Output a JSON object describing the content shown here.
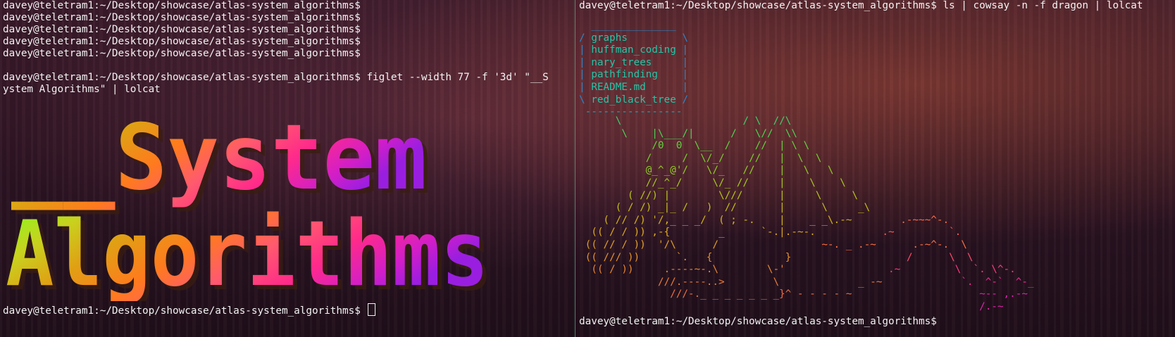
{
  "left_terminal": {
    "prompt": "davey@teletram1:~/Desktop/showcase/atlas-system_algorithms$",
    "history": [
      "davey@teletram1:~/Desktop/showcase/atlas-system_algorithms$",
      "davey@teletram1:~/Desktop/showcase/atlas-system_algorithms$",
      "davey@teletram1:~/Desktop/showcase/atlas-system_algorithms$",
      "davey@teletram1:~/Desktop/showcase/atlas-system_algorithms$",
      "davey@teletram1:~/Desktop/showcase/atlas-system_algorithms$"
    ],
    "command_line_1": "davey@teletram1:~/Desktop/showcase/atlas-system_algorithms$ figlet --width 77 -f '3d' \"__S",
    "command_line_2": "ystem Algorithms\" | lolcat",
    "banner_line_1": "__System",
    "banner_line_2": "Algorithms"
  },
  "right_terminal": {
    "command": "davey@teletram1:~/Desktop/showcase/atlas-system_algorithms$ ls | cowsay -n -f dragon | lolcat",
    "listing": [
      "graphs",
      "huffman_coding",
      "nary_trees",
      "pathfinding",
      "README.md",
      "red_black_tree"
    ],
    "prompt": "davey@teletram1:~/Desktop/showcase/atlas-system_algorithms$"
  },
  "colors": {
    "terminal_text": "#f2f2f2",
    "divider": "#4fa07a",
    "lolcat_gradient": [
      "#7dff1e",
      "#c8d21e",
      "#e0a014",
      "#ff7a1e",
      "#ff5a6e",
      "#ff2a8a",
      "#d21ec8",
      "#9a1ee0"
    ]
  }
}
